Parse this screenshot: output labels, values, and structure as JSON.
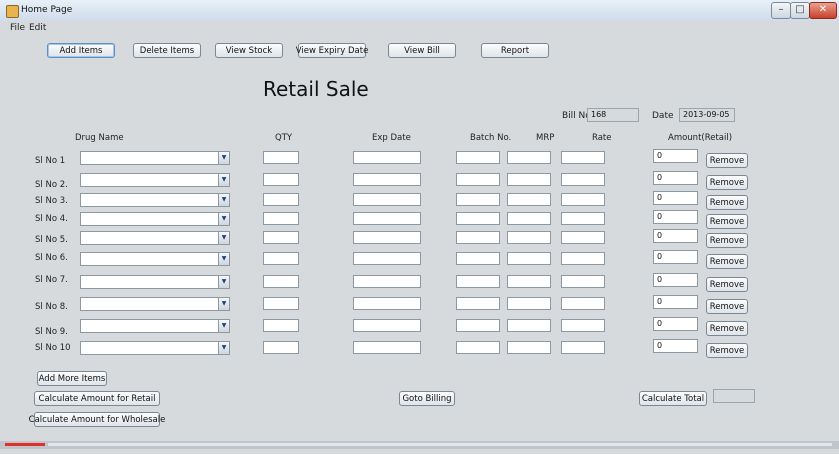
{
  "window": {
    "title": "Home Page"
  },
  "menu": {
    "file": "File",
    "edit": "Edit"
  },
  "toolbar": {
    "add_items": "Add Items",
    "delete_items": "Delete Items",
    "view_stock": "View Stock",
    "view_expiry_date": "View Expiry Date",
    "view_bill": "View Bill",
    "report": "Report"
  },
  "page_title": "Retail Sale",
  "bill": {
    "label": "Bill No",
    "value": "168",
    "date_label": "Date",
    "date_value": "2013-09-05"
  },
  "columns": {
    "drug_name": "Drug Name",
    "qty": "QTY",
    "exp_date": "Exp Date",
    "batch_no": "Batch No.",
    "mrp": "MRP",
    "rate": "Rate",
    "amount": "Amount(Retail)"
  },
  "rows": [
    {
      "label": "Sl No 1",
      "amount": "0",
      "remove": "Remove"
    },
    {
      "label": "Sl No 2.",
      "amount": "0",
      "remove": "Remove"
    },
    {
      "label": "Sl No 3.",
      "amount": "0",
      "remove": "Remove"
    },
    {
      "label": "Sl No 4.",
      "amount": "0",
      "remove": "Remove"
    },
    {
      "label": "Sl No 5.",
      "amount": "0",
      "remove": "Remove"
    },
    {
      "label": "Sl No 6.",
      "amount": "0",
      "remove": "Remove"
    },
    {
      "label": "Sl No 7.",
      "amount": "0",
      "remove": "Remove"
    },
    {
      "label": "Sl No 8.",
      "amount": "0",
      "remove": "Remove"
    },
    {
      "label": "Sl No 9.",
      "amount": "0",
      "remove": "Remove"
    },
    {
      "label": "Sl No 10",
      "amount": "0",
      "remove": "Remove"
    }
  ],
  "actions": {
    "add_more_items": "Add More Items",
    "calc_retail": "Calculate Amount for Retail",
    "calc_wholesale": "Calculate Amount for Wholesale",
    "goto_billing": "Goto Billing",
    "calculate_total": "Calculate Total",
    "total_value": ""
  },
  "icons": {
    "combo_arrow": "chevron-down-icon",
    "app": "java-cup-icon"
  }
}
